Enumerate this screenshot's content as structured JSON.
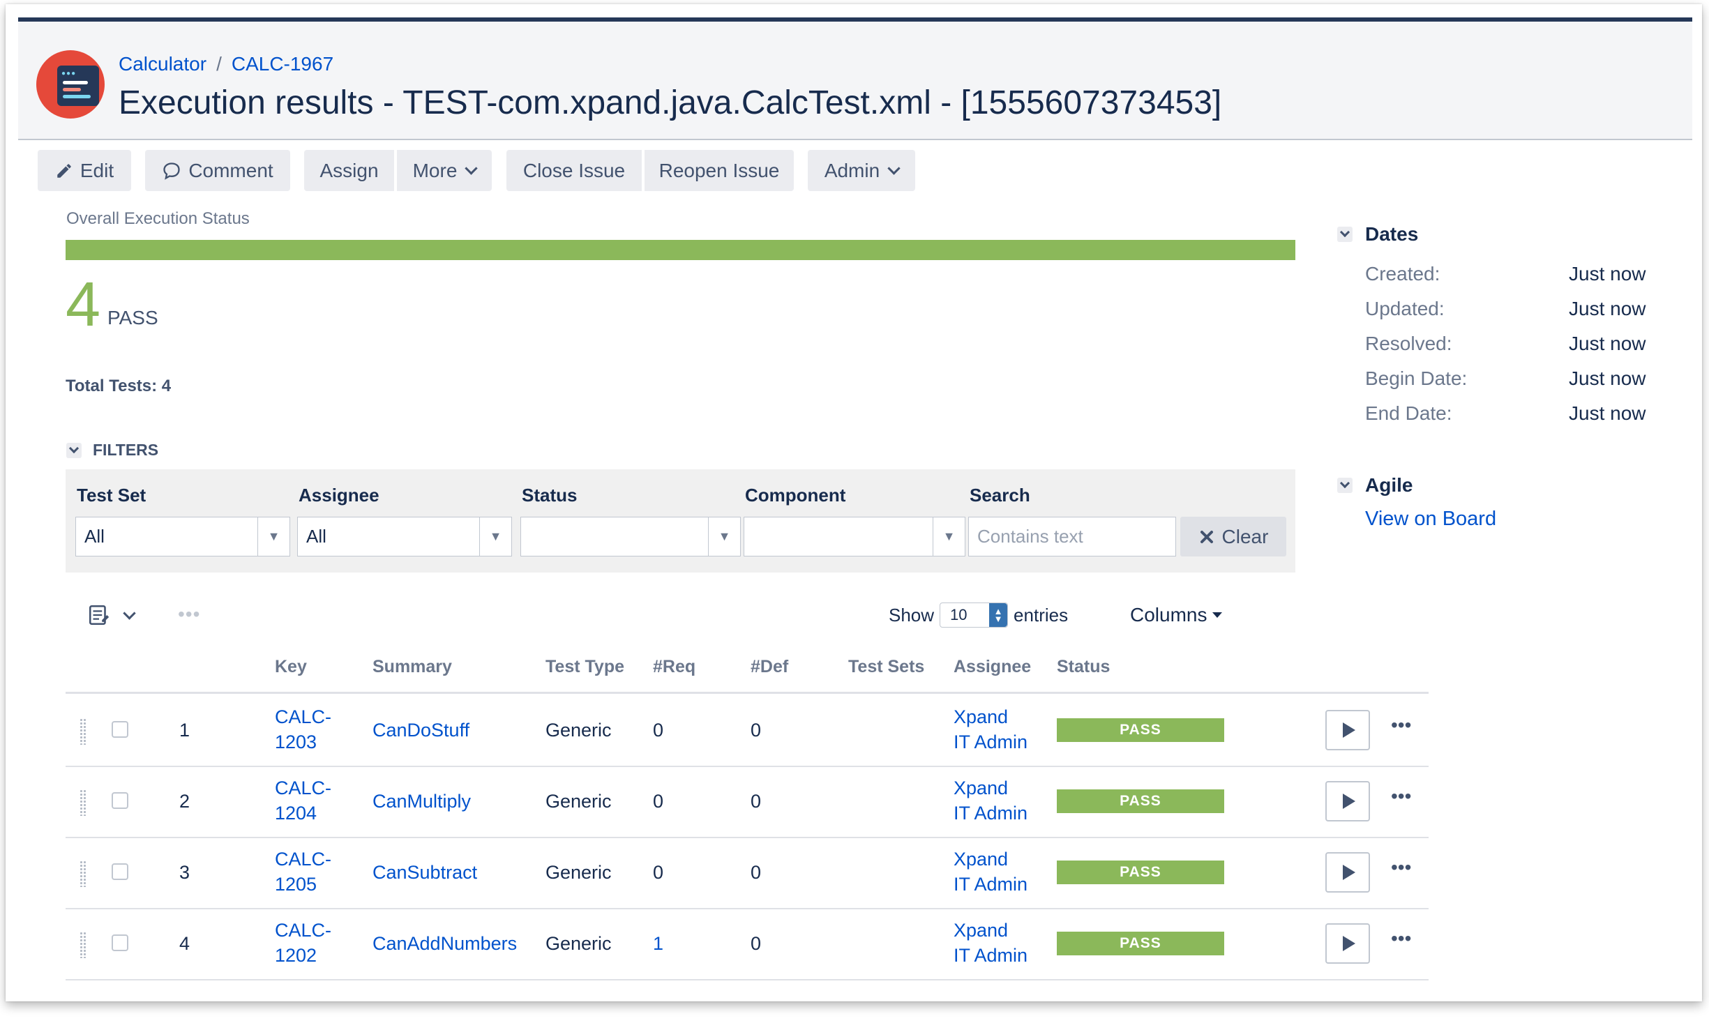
{
  "breadcrumb": {
    "project": "Calculator",
    "separator": "/",
    "issue_key": "CALC-1967"
  },
  "page_title": "Execution results - TEST-com.xpand.java.CalcTest.xml - [1555607373453]",
  "toolbar": {
    "edit": "Edit",
    "comment": "Comment",
    "assign": "Assign",
    "more": "More",
    "close_issue": "Close Issue",
    "reopen_issue": "Reopen Issue",
    "admin": "Admin"
  },
  "execution": {
    "section_label": "Overall Execution Status",
    "pass_fraction": 1.0,
    "count": "4",
    "count_label": "PASS",
    "total_tests": "Total Tests: 4"
  },
  "filters": {
    "header": "FILTERS",
    "test_set_label": "Test Set",
    "test_set_value": "All",
    "assignee_label": "Assignee",
    "assignee_value": "All",
    "status_label": "Status",
    "status_value": "",
    "component_label": "Component",
    "component_value": "",
    "search_label": "Search",
    "search_placeholder": "Contains text",
    "clear": "Clear"
  },
  "table_controls": {
    "show": "Show",
    "page_size": "10",
    "entries": "entries",
    "columns": "Columns"
  },
  "table": {
    "headers": {
      "key": "Key",
      "summary": "Summary",
      "test_type": "Test Type",
      "req": "#Req",
      "def": "#Def",
      "test_sets": "Test Sets",
      "assignee": "Assignee",
      "status": "Status"
    },
    "rows": [
      {
        "index": "1",
        "key_a": "CALC-",
        "key_b": "1203",
        "summary": "CanDoStuff",
        "test_type": "Generic",
        "req": "0",
        "def": "0",
        "assignee_a": "Xpand",
        "assignee_b": "IT Admin",
        "status": "PASS"
      },
      {
        "index": "2",
        "key_a": "CALC-",
        "key_b": "1204",
        "summary": "CanMultiply",
        "test_type": "Generic",
        "req": "0",
        "def": "0",
        "assignee_a": "Xpand",
        "assignee_b": "IT Admin",
        "status": "PASS"
      },
      {
        "index": "3",
        "key_a": "CALC-",
        "key_b": "1205",
        "summary": "CanSubtract",
        "test_type": "Generic",
        "req": "0",
        "def": "0",
        "assignee_a": "Xpand",
        "assignee_b": "IT Admin",
        "status": "PASS"
      },
      {
        "index": "4",
        "key_a": "CALC-",
        "key_b": "1202",
        "summary": "CanAddNumbers",
        "test_type": "Generic",
        "req": "1",
        "def": "0",
        "assignee_a": "Xpand",
        "assignee_b": "IT Admin",
        "status": "PASS"
      }
    ]
  },
  "dates": {
    "header": "Dates",
    "created_label": "Created:",
    "created": "Just now",
    "updated_label": "Updated:",
    "updated": "Just now",
    "resolved_label": "Resolved:",
    "resolved": "Just now",
    "begin_label": "Begin Date:",
    "begin": "Just now",
    "end_label": "End Date:",
    "end": "Just now"
  },
  "agile": {
    "header": "Agile",
    "link": "View on Board"
  },
  "colors": {
    "pass": "#8bb85a",
    "link": "#0052cc",
    "header_bar": "#253858",
    "logo": "#e5493a"
  }
}
